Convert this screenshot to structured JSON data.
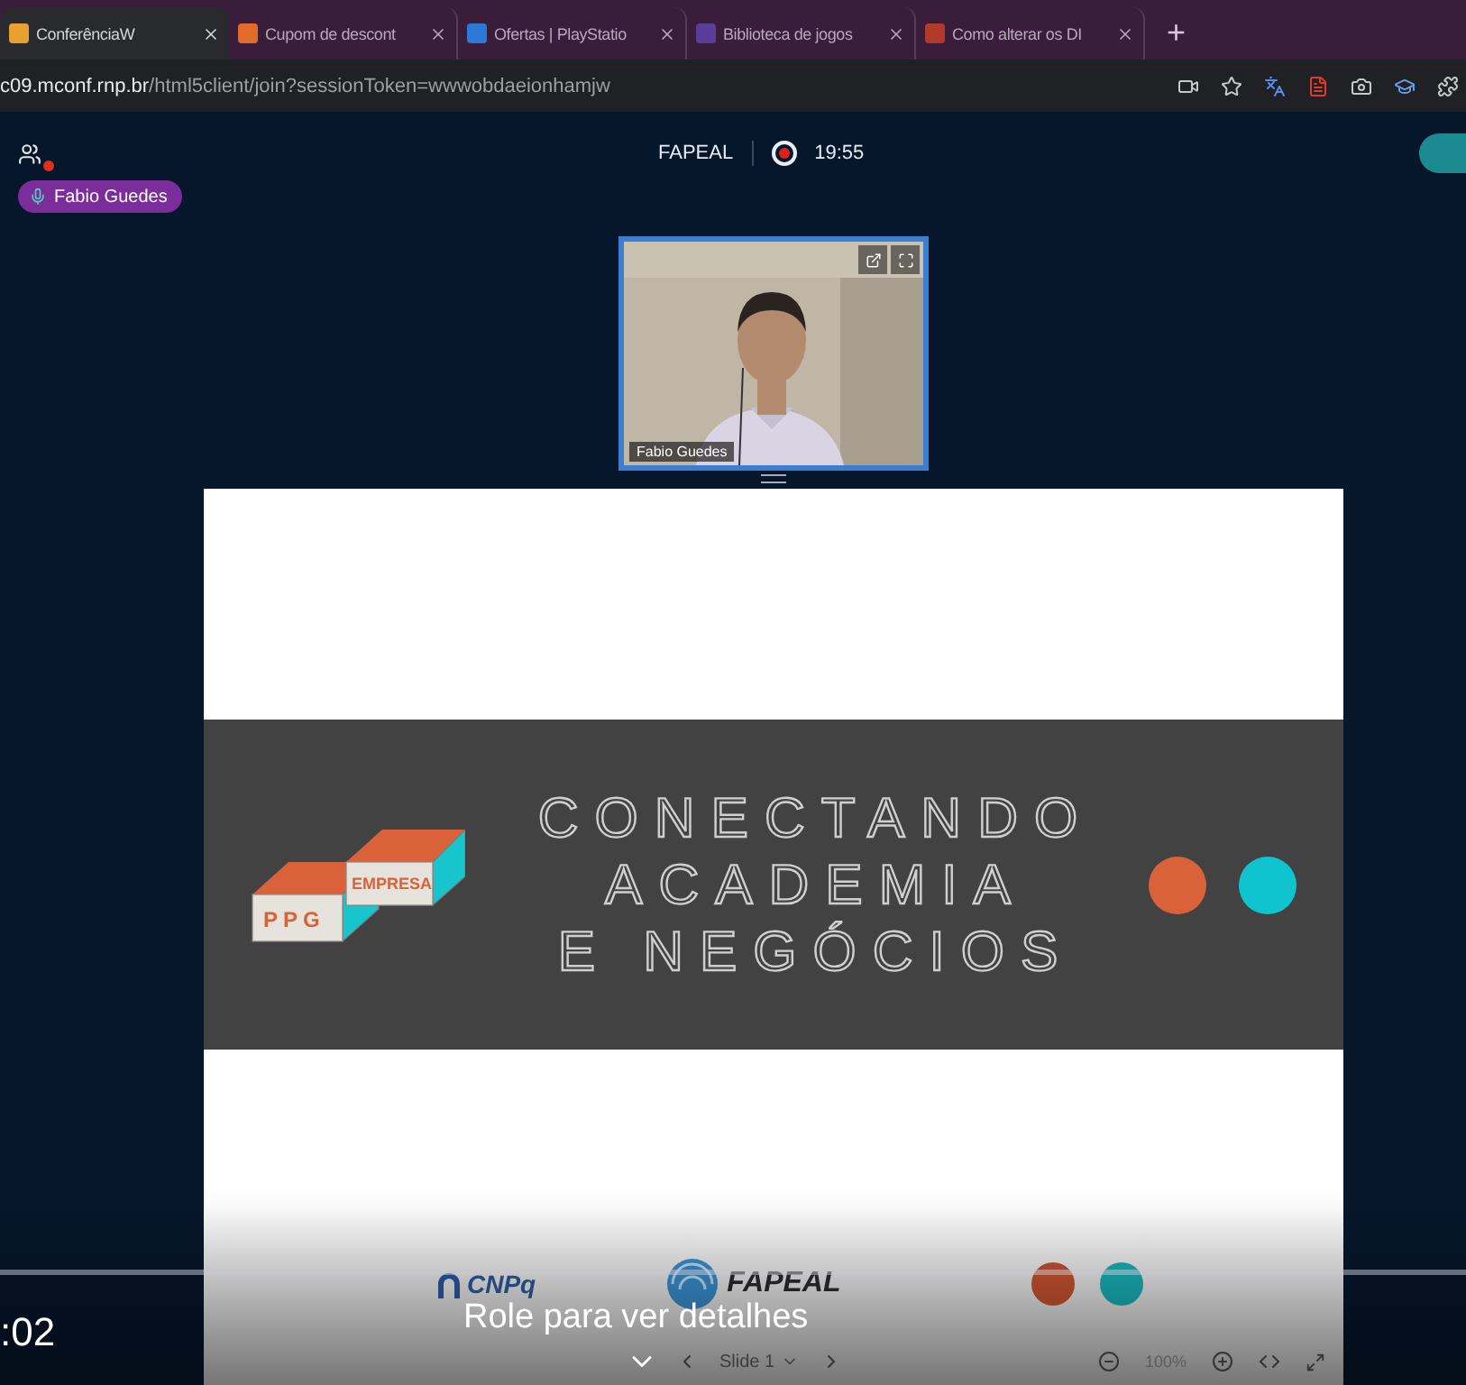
{
  "browser": {
    "tabs": [
      {
        "title": "ConferênciaW",
        "selected": true
      },
      {
        "title": "Cupom de descont",
        "selected": false
      },
      {
        "title": "Ofertas | PlayStatio",
        "selected": false
      },
      {
        "title": "Biblioteca de jogos",
        "selected": false
      },
      {
        "title": "Como alterar os DI",
        "selected": false
      }
    ],
    "new_tab": "+",
    "url_host": "c09.mconf.rnp.br",
    "url_path": "/html5client/join?sessionToken=wwwobdaeionhamjw"
  },
  "meeting": {
    "title": "FAPEAL",
    "recording_time": "19:55",
    "presenter": "Fabio Guedes"
  },
  "webcam": {
    "name": "Fabio Guedes"
  },
  "slide": {
    "title_lines": [
      "CONECTANDO",
      "ACADEMIA",
      "E NEGÓCIOS"
    ],
    "logo_top": "EMPRESA",
    "logo_bottom": "PPG",
    "footer_logos": [
      "CNPq",
      "FAPEAL"
    ]
  },
  "slide_toolbar": {
    "slide": "Slide 1",
    "zoom": "100%"
  },
  "player": {
    "time": ":02",
    "hint": "Role para ver detalhes"
  }
}
